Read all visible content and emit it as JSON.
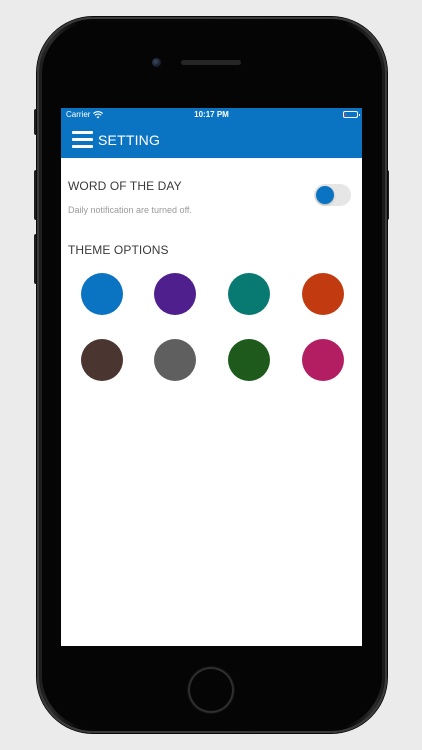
{
  "status_bar": {
    "carrier": "Carrier",
    "time": "10:17 PM",
    "wifi_icon": "wifi-icon",
    "battery_icon": "battery-icon",
    "battery_level": 0.12
  },
  "navbar": {
    "menu_icon": "hamburger-menu-icon",
    "title": "SETTING",
    "color": "#0b74c2"
  },
  "word_of_the_day": {
    "title": "WORD OF THE DAY",
    "subtitle": "Daily notification are turned off.",
    "toggle_on": false
  },
  "theme_options": {
    "title": "THEME OPTIONS",
    "colors": [
      "#0b74c2",
      "#4f1f8e",
      "#097a72",
      "#c23a10",
      "#4b3530",
      "#5f5f5f",
      "#1e5a1c",
      "#b31e63"
    ]
  }
}
